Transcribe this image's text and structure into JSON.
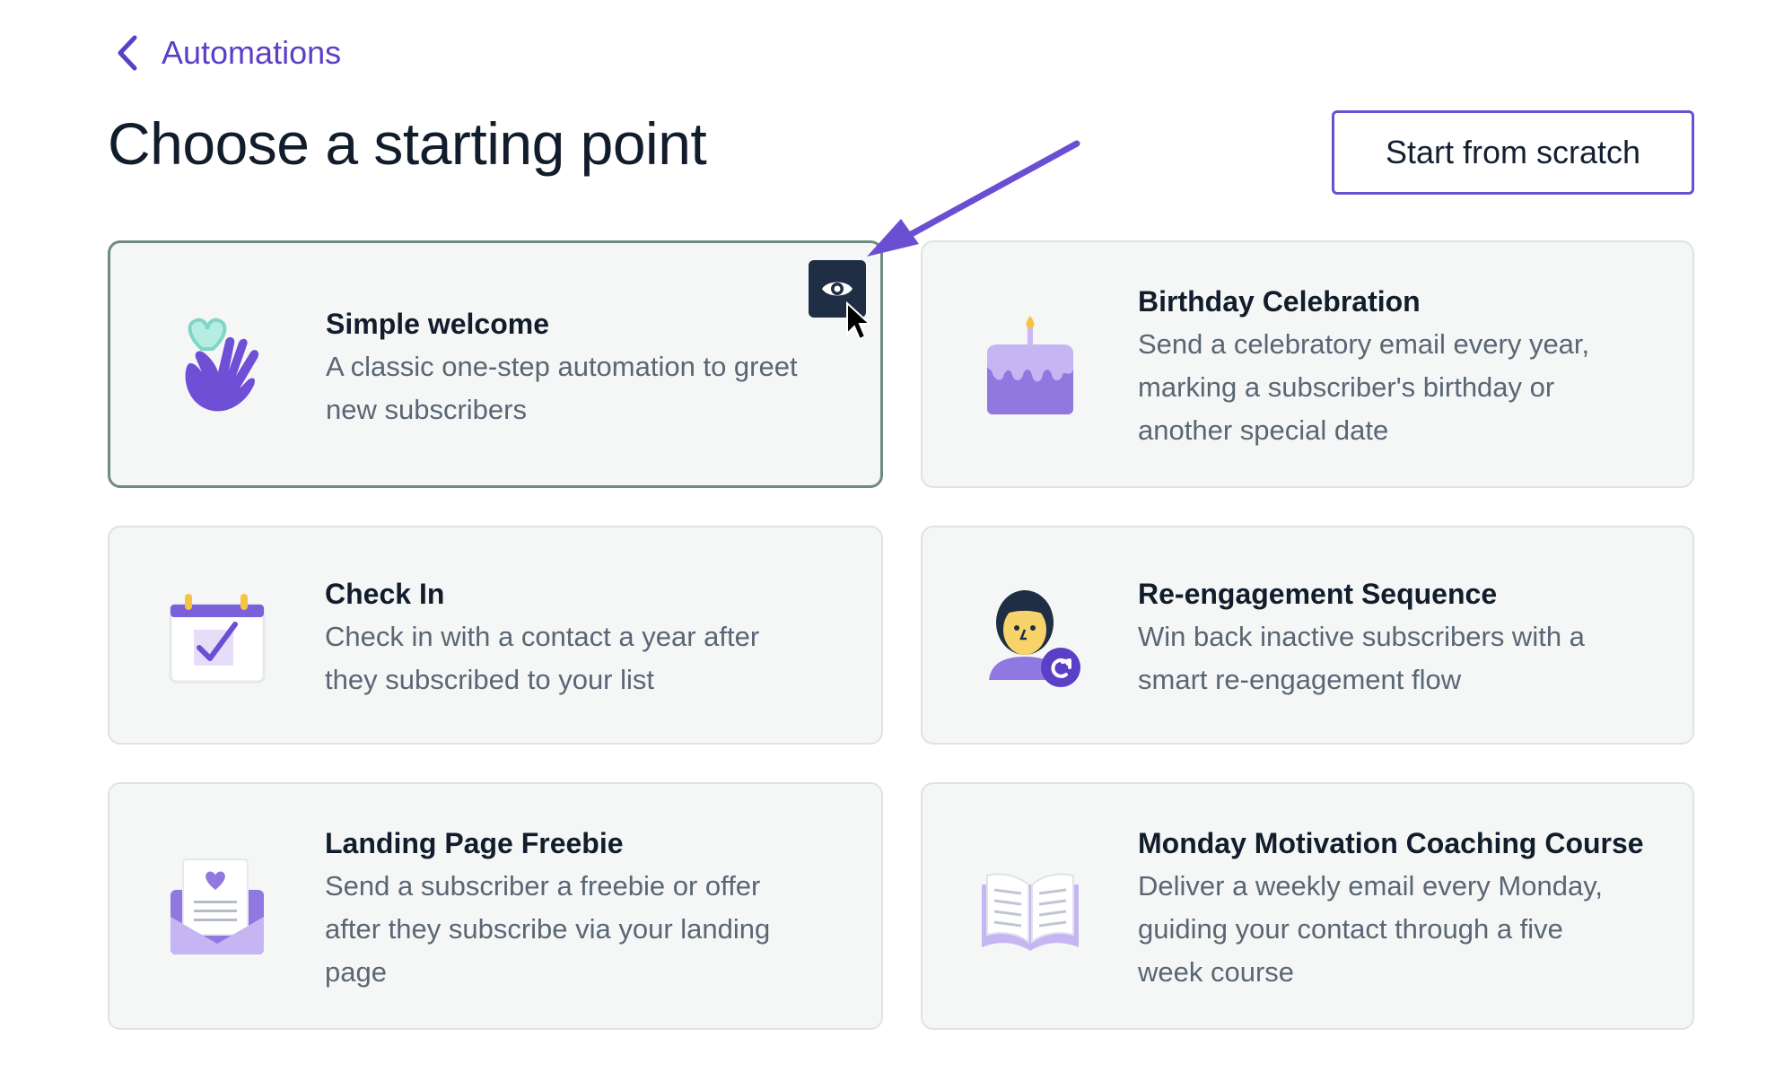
{
  "nav": {
    "back_label": "Automations"
  },
  "page": {
    "title": "Choose a starting point",
    "scratch_label": "Start from scratch"
  },
  "cards": [
    {
      "title": "Simple welcome",
      "desc_lines": [
        "A classic one-step automation to greet",
        "new subscribers"
      ],
      "icon": "waving-hand-heart-icon",
      "selected": true
    },
    {
      "title": "Birthday Celebration",
      "desc_lines": [
        "Send a celebratory email every year,",
        "marking a subscriber's birthday or",
        "another special date"
      ],
      "icon": "birthday-cake-icon"
    },
    {
      "title": "Check In",
      "desc_lines": [
        "Check in with a contact a year after",
        "they subscribed to your list"
      ],
      "icon": "calendar-check-icon"
    },
    {
      "title": "Re-engagement Sequence",
      "desc_lines": [
        "Win back inactive subscribers with a",
        "smart re-engagement flow"
      ],
      "icon": "person-refresh-icon"
    },
    {
      "title": "Landing Page Freebie",
      "desc_lines": [
        "Send a subscriber a freebie or offer",
        "after they subscribe via your landing",
        "page"
      ],
      "icon": "envelope-heart-icon"
    },
    {
      "title": "Monday Motivation Coaching Course",
      "desc_lines": [
        "Deliver a weekly email every Monday,",
        "guiding your contact through a five",
        "week course"
      ],
      "icon": "open-book-icon"
    }
  ],
  "colors": {
    "accent": "#5a3fc7",
    "selected_border": "#6f8a84",
    "preview_button": "#1f2d45"
  },
  "icons": {
    "preview": "eye-icon",
    "cursor": "mouse-pointer-icon",
    "annotation": "arrow-annotation"
  }
}
